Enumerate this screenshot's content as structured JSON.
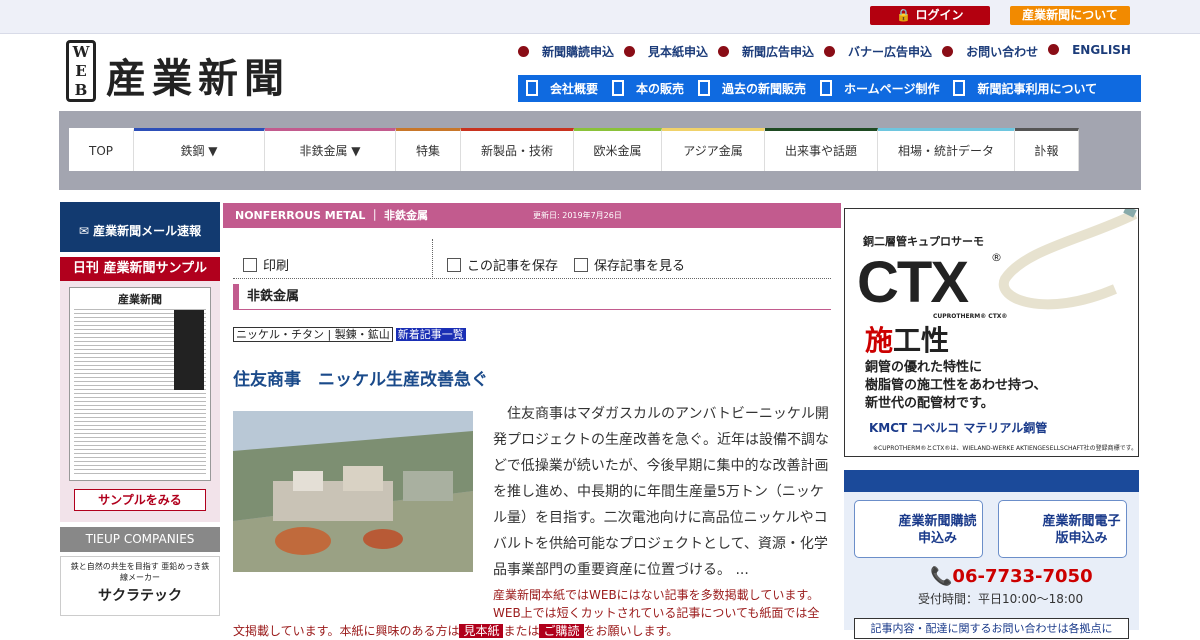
{
  "header": {
    "login": "ログイン",
    "about": "産業新聞について",
    "logo_web": [
      "W",
      "E",
      "B"
    ],
    "logo_name": "産業新聞",
    "links": [
      "新聞購読申込",
      "見本紙申込",
      "新聞広告申込",
      "バナー広告申込",
      "お問い合わせ",
      "ENGLISH"
    ],
    "bluebar": [
      "会社概要",
      "本の販売",
      "過去の新聞販売",
      "ホームページ制作",
      "新聞記事利用について"
    ]
  },
  "nav": [
    {
      "label": "TOP",
      "color": "#ffffff"
    },
    {
      "label": "鉄鋼 ▼",
      "color": "#2d4fb8"
    },
    {
      "label": "非鉄金属 ▼",
      "color": "#c25b8e"
    },
    {
      "label": "特集",
      "color": "#c8772a"
    },
    {
      "label": "新製品・技術",
      "color": "#c8331f"
    },
    {
      "label": "欧米金属",
      "color": "#8ac23a"
    },
    {
      "label": "アジア金属",
      "color": "#f0d26a"
    },
    {
      "label": "出来事や話題",
      "color": "#1e4a22"
    },
    {
      "label": "相場・統計データ",
      "color": "#6ec6df"
    },
    {
      "label": "訃報",
      "color": "#555555"
    }
  ],
  "left": {
    "mail": "産業新聞メール速報",
    "sample_title": "日刊 産業新聞サンプル",
    "sample_paper": "産業新聞",
    "sample_button": "サンプルをみる",
    "tieup": "TIEUP COMPANIES",
    "tieup_ad_small": "鉄と自然の共生を目指す 亜鉛めっき鉄線メーカー",
    "tieup_ad_name": "サクラテック"
  },
  "main": {
    "category": "NONFERROUS METAL ｜ 非鉄金属",
    "updated": "更新日: 2019年7月26日",
    "print": "印刷",
    "save": "この記事を保存",
    "view_saved": "保存記事を見る",
    "section": "非鉄金属",
    "tag": "ニッケル・チタン | 製錬・鉱山",
    "new_list": "新着記事一覧",
    "headline": "住友商事　ニッケル生産改善急ぐ",
    "body": "住友商事はマダガスカルのアンバトビーニッケル開発プロジェクトの生産改善を急ぐ。近年は設備不調などで低操業が続いたが、今後早期に集中的な改善計画を推し進め、中長期的に年間生産量5万トン（ニッケル量）を目指す。二次電池向けに高品位ニッケルやコバルトを供給可能なプロジェクトとして、資源・化学品事業部門の重要資産に位置づける。 ...",
    "note": "産業新聞本紙ではWEBにはない記事を多数掲載しています。WEB上では短くカットされている記事についても紙面では全",
    "note2_a": "文掲載しています。本紙に興味のある方は",
    "note2_b": "見本紙",
    "note2_c": "または",
    "note2_d": "ご購読",
    "note2_e": "をお願いします。"
  },
  "ad": {
    "line1": "銅二層管キュプロサーモ",
    "ctx": "CTX",
    "reg": "®",
    "sub": "CUPROTHERM® CTX®",
    "catch_red": "施",
    "catch": "工性",
    "desc": "銅管の優れた特性に\n樹脂管の施工性をあわせ持つ、\n新世代の配管材です。",
    "brand": "KMCT コベルコ マテリアル銅管",
    "fine": "※CUPROTHERM®とCTX®は、WIELAND-WERKE AKTIENGESELLSCHAFT社の登録商標です。"
  },
  "subscribe": {
    "btn1": "産業新聞購読申込み",
    "btn2": "産業新聞電子版申込み",
    "phone": "06-7733-7050",
    "hours": "受付時間：平日10:00～18:00",
    "inquiry": "記事内容・配達に関するお問い合わせは各拠点に"
  }
}
